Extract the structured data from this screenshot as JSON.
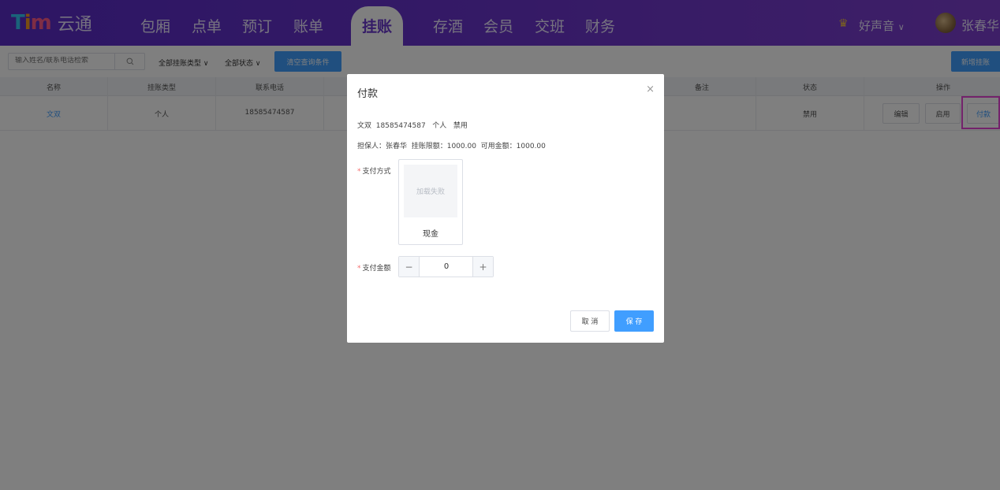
{
  "header": {
    "brand_mark": "TiM",
    "brand_name": "云通",
    "nav": [
      "包厢",
      "点单",
      "预订",
      "账单",
      "挂账",
      "存酒",
      "会员",
      "交班",
      "财务"
    ],
    "active_nav": "挂账",
    "store_name": "好声音",
    "store_chevron": "∨",
    "user_name": "张春华"
  },
  "toolbar": {
    "search_placeholder": "输入姓名/联系电话检索",
    "type_filter": "全部挂账类型 ∨",
    "status_filter": "全部状态 ∨",
    "clear_label": "清空查询条件",
    "new_label": "新增挂账"
  },
  "table": {
    "headers": [
      "名称",
      "挂账类型",
      "联系电话",
      "备注",
      "状态",
      "操作"
    ],
    "row": {
      "name": "文双",
      "type": "个人",
      "phone": "18585474587",
      "status": "禁用",
      "actions": [
        "编辑",
        "启用",
        "付款"
      ]
    }
  },
  "modal": {
    "title": "付款",
    "close": "×",
    "info_line1": "文双  18585474587   个人   禁用",
    "info_line2": "担保人：张春华  挂账限额：1000.00  可用金额：1000.00",
    "required_mark": "*",
    "pay_method_label": "支付方式",
    "pay_image_text": "加载失败",
    "pay_method_name": "现金",
    "amount_label": "支付金额",
    "amount_value": "0",
    "minus": "−",
    "plus": "+",
    "cancel_label": "取 消",
    "save_label": "保 存"
  },
  "colors": {
    "primary": "#409eff",
    "nav_gradient_start": "#5a2cc9",
    "nav_gradient_end": "#7d3fcf",
    "highlight": "#e645d6",
    "required": "#f56c6c"
  }
}
